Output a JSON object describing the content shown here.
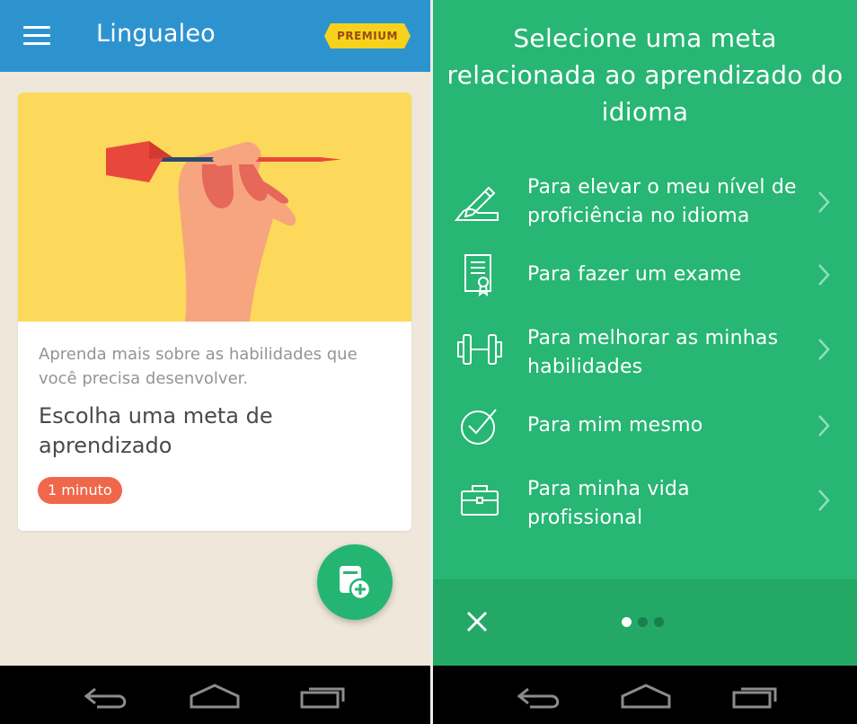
{
  "left": {
    "appbar": {
      "title": "Lingualeo",
      "premium_label": "PREMIUM",
      "menu_icon": "hamburger-menu-icon"
    },
    "card": {
      "subtitle": "Aprenda mais sobre as habilidades que você precisa desenvolver.",
      "title": "Escolha uma meta de aprendizado",
      "badge": "1 minuto"
    },
    "fab_icon": "add-document-icon"
  },
  "right": {
    "title": "Selecione uma meta relacionada ao aprendizado do idioma",
    "options": [
      {
        "label": "Para elevar o meu nível de proficiência no idioma",
        "icon": "pen-hand-icon"
      },
      {
        "label": "Para fazer um exame",
        "icon": "certificate-icon"
      },
      {
        "label": "Para melhorar as minhas habilidades",
        "icon": "dumbbell-icon"
      },
      {
        "label": "Para mim mesmo",
        "icon": "check-circle-icon"
      },
      {
        "label": "Para minha vida profissional",
        "icon": "briefcase-icon"
      }
    ],
    "pager": {
      "total": 3,
      "active": 1
    }
  },
  "navbar": [
    "back-icon",
    "home-icon",
    "recent-apps-icon"
  ],
  "colors": {
    "appbar_blue": "#2d93cf",
    "background_beige": "#efe8da",
    "card_art_yellow": "#fcd95a",
    "badge_red": "#f0674a",
    "green_primary": "#27b673",
    "green_dark": "#23a866",
    "premium_yellow": "#f7d21c"
  }
}
